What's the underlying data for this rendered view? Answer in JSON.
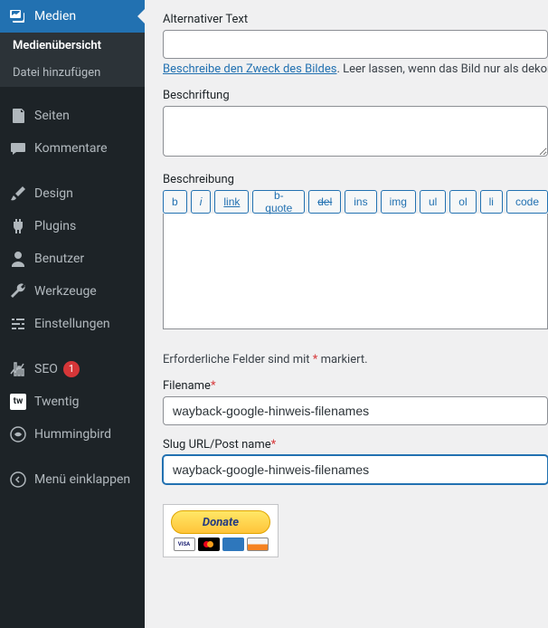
{
  "sidebar": {
    "active": {
      "label": "Medien"
    },
    "submenu": [
      {
        "label": "Medienübersicht",
        "current": true
      },
      {
        "label": "Datei hinzufügen",
        "current": false
      }
    ],
    "items": [
      {
        "label": "Seiten",
        "icon": "pages-icon"
      },
      {
        "label": "Kommentare",
        "icon": "comments-icon"
      }
    ],
    "items2": [
      {
        "label": "Design",
        "icon": "brush-icon"
      },
      {
        "label": "Plugins",
        "icon": "plug-icon"
      },
      {
        "label": "Benutzer",
        "icon": "user-icon"
      },
      {
        "label": "Werkzeuge",
        "icon": "wrench-icon"
      },
      {
        "label": "Einstellungen",
        "icon": "sliders-icon"
      }
    ],
    "items3": [
      {
        "label": "SEO",
        "icon": "seo-icon",
        "badge": "1"
      },
      {
        "label": "Twentig",
        "icon": "tw-icon"
      },
      {
        "label": "Hummingbird",
        "icon": "hummingbird-icon"
      }
    ],
    "collapse": {
      "label": "Menü einklappen"
    }
  },
  "form": {
    "alt_label": "Alternativer Text",
    "alt_value": "",
    "alt_help_link": "Beschreibe den Zweck des Bildes",
    "alt_help_rest": ". Leer lassen, wenn das Bild nur als dekor",
    "caption_label": "Beschriftung",
    "caption_value": "",
    "desc_label": "Beschreibung",
    "toolbar": [
      "b",
      "i",
      "link",
      "b-quote",
      "del",
      "ins",
      "img",
      "ul",
      "ol",
      "li",
      "code"
    ],
    "desc_value": "",
    "required_note_pre": "Erforderliche Felder sind mit ",
    "required_note_post": " markiert.",
    "filename_label": "Filename",
    "filename_value": "wayback-google-hinweis-filenames",
    "slug_label": "Slug URL/Post name",
    "slug_value": "wayback-google-hinweis-filenames",
    "donate_label": "Donate",
    "cards": [
      "VISA",
      "",
      "",
      ""
    ]
  }
}
